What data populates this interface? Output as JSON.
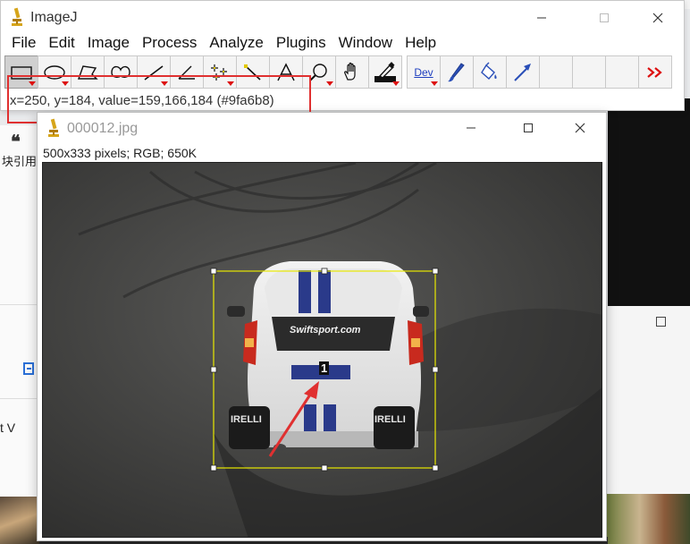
{
  "main_window": {
    "title": "ImageJ",
    "menu": [
      "File",
      "Edit",
      "Image",
      "Process",
      "Analyze",
      "Plugins",
      "Window",
      "Help"
    ],
    "tools": [
      {
        "name": "rectangle-tool",
        "icon": "rectangle-icon"
      },
      {
        "name": "oval-tool",
        "icon": "oval-icon"
      },
      {
        "name": "polygon-tool",
        "icon": "polygon-icon"
      },
      {
        "name": "freehand-tool",
        "icon": "freehand-icon"
      },
      {
        "name": "line-tool",
        "icon": "line-icon"
      },
      {
        "name": "angle-tool",
        "icon": "angle-icon"
      },
      {
        "name": "point-tool",
        "icon": "point-icon"
      },
      {
        "name": "wand-tool",
        "icon": "wand-icon"
      },
      {
        "name": "text-tool",
        "icon": "text-icon"
      },
      {
        "name": "magnifier-tool",
        "icon": "magnifier-icon"
      },
      {
        "name": "hand-tool",
        "icon": "hand-icon"
      },
      {
        "name": "color-picker-tool",
        "icon": "dropper-icon"
      },
      {
        "name": "dev-tool",
        "label": "Dev"
      },
      {
        "name": "brush-tool",
        "icon": "brush-icon"
      },
      {
        "name": "flood-fill-tool",
        "icon": "flood-fill-icon"
      },
      {
        "name": "arrow-tool",
        "icon": "arrow-icon"
      },
      {
        "name": "empty-slot-1"
      },
      {
        "name": "empty-slot-2"
      },
      {
        "name": "empty-slot-3"
      },
      {
        "name": "more-tools",
        "icon": "double-chevron-right-icon"
      }
    ],
    "status": "x=250, y=184, value=159,166,184 (#9fa6b8)"
  },
  "image_window": {
    "title": "000012.jpg",
    "info": "500x333 pixels; RGB; 650K",
    "overlay_label": "1",
    "car_text": "Swiftsport.com",
    "tire_text": "IRELLI"
  },
  "background": {
    "left_text_1": "块引用",
    "left_text_2": "t  V"
  },
  "colors": {
    "annotation": "#e03030",
    "selection": "#e8e800",
    "stripe": "#2a3a8a"
  }
}
